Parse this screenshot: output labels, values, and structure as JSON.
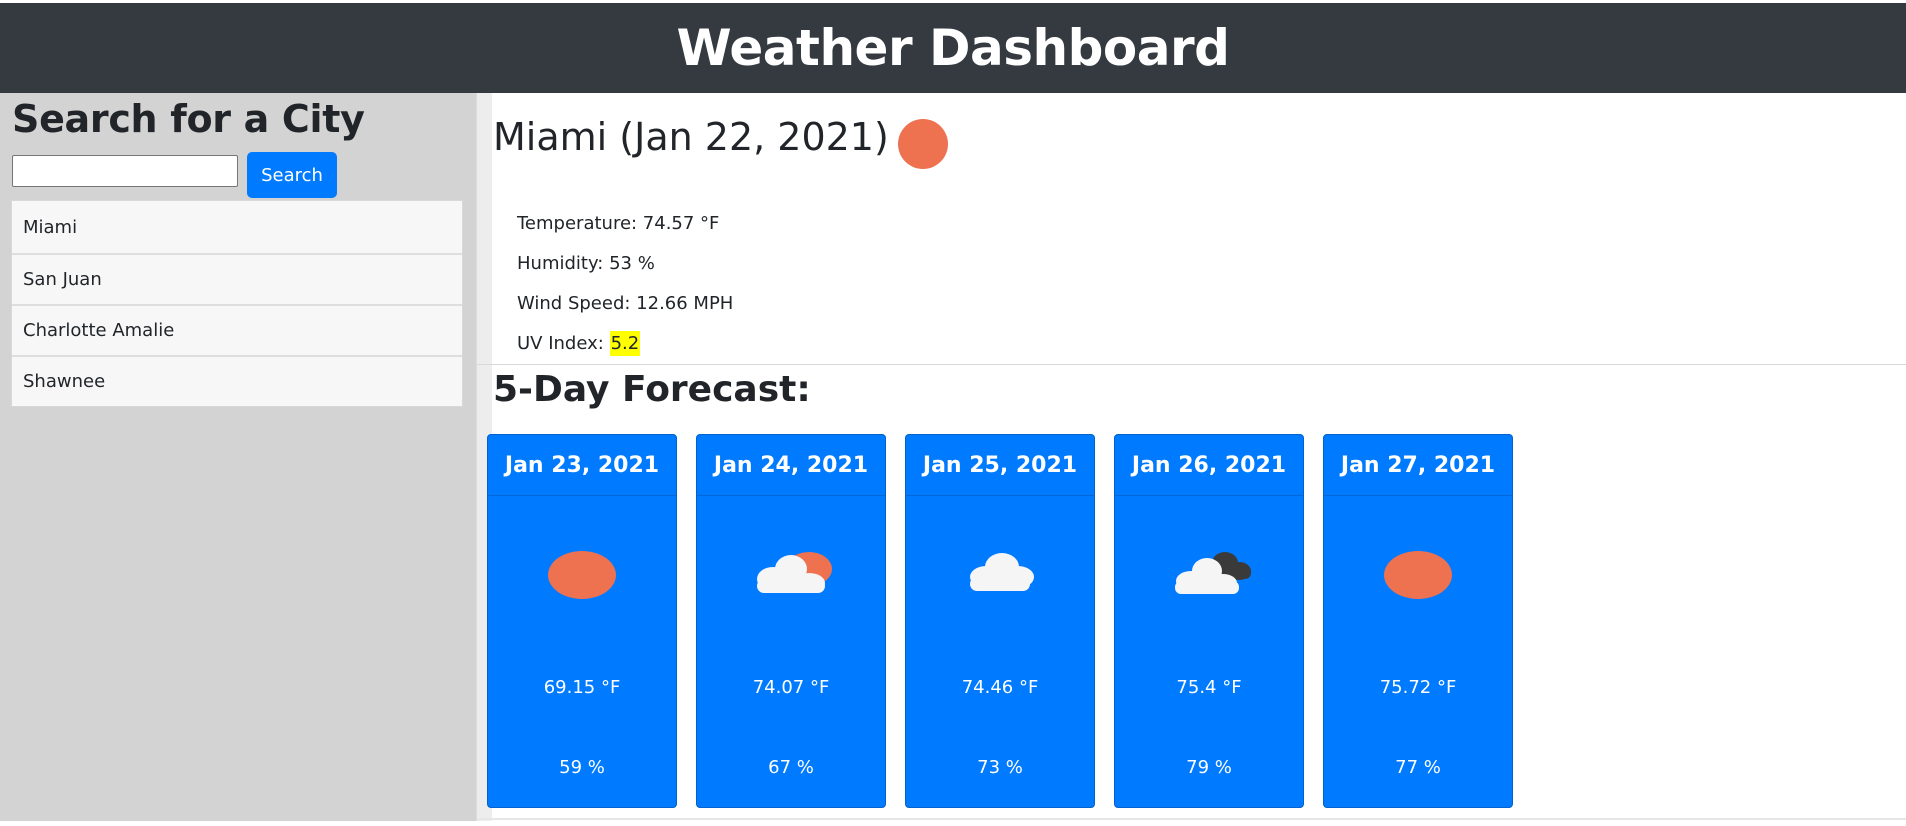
{
  "header": {
    "title": "Weather Dashboard"
  },
  "sidebar": {
    "title": "Search for a City",
    "search": {
      "value": "",
      "placeholder": "",
      "button_label": "Search"
    },
    "cities": [
      "Miami",
      "San Juan",
      "Charlotte Amalie",
      "Shawnee"
    ]
  },
  "current": {
    "title": "Miami (Jan 22, 2021)",
    "icon": "sun-icon",
    "temperature": "Temperature: 74.57 °F",
    "humidity": "Humidity: 53 %",
    "wind": "Wind Speed: 12.66 MPH",
    "uv_label": "UV Index: ",
    "uv_value": "5.2",
    "uv_color": "#ffff00"
  },
  "forecast": {
    "title": "5-Day Forecast:",
    "days": [
      {
        "date": "Jan 23, 2021",
        "icon": "clear-sun-icon",
        "temp": "69.15 °F",
        "humidity": "59 %"
      },
      {
        "date": "Jan 24, 2021",
        "icon": "few-clouds-icon",
        "temp": "74.07 °F",
        "humidity": "67 %"
      },
      {
        "date": "Jan 25, 2021",
        "icon": "cloud-icon",
        "temp": "74.46 °F",
        "humidity": "73 %"
      },
      {
        "date": "Jan 26, 2021",
        "icon": "broken-clouds-icon",
        "temp": "75.4 °F",
        "humidity": "79 %"
      },
      {
        "date": "Jan 27, 2021",
        "icon": "clear-sun-icon",
        "temp": "75.72 °F",
        "humidity": "77 %"
      }
    ]
  },
  "colors": {
    "header_bg": "#343a40",
    "sidebar_bg": "#d3d3d3",
    "accent": "#007bff",
    "sun": "#ee7150",
    "uv_badge": "#ffff00"
  }
}
